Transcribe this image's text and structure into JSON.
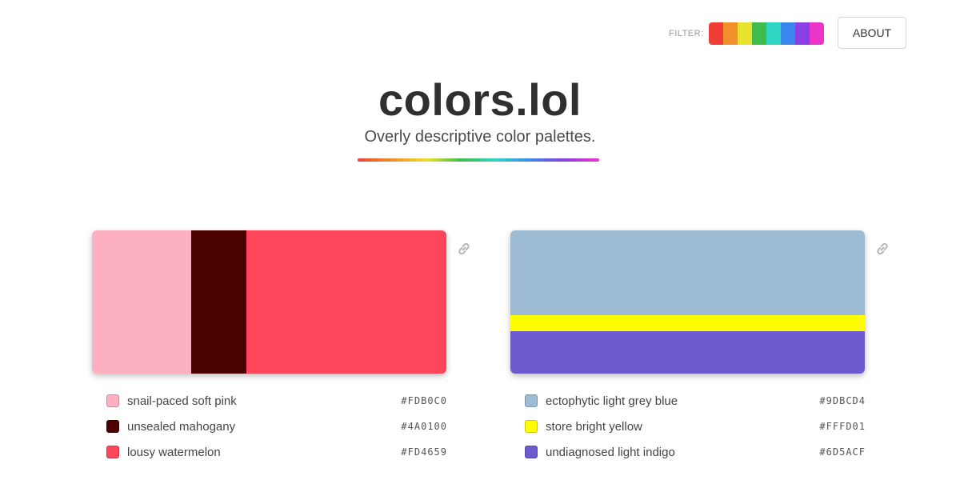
{
  "header": {
    "filter_label": "FILTER:",
    "filter_colors": [
      "#ef3e36",
      "#f08f2c",
      "#e9e22c",
      "#3fbc4d",
      "#2fd4c2",
      "#3a86ec",
      "#8a3ee6",
      "#ec34c9"
    ],
    "about_label": "ABOUT"
  },
  "hero": {
    "title": "colors.lol",
    "subtitle": "Overly descriptive color palettes."
  },
  "palettes": [
    {
      "orientation": "horizontal",
      "link_icon": "link-icon",
      "colors": [
        {
          "name": "snail-paced soft pink",
          "hex": "#FDB0C0",
          "share": 0.28
        },
        {
          "name": "unsealed mahogany",
          "hex": "#4A0100",
          "share": 0.155
        },
        {
          "name": "lousy watermelon",
          "hex": "#FD4659",
          "share": 0.565
        }
      ]
    },
    {
      "orientation": "vertical",
      "link_icon": "link-icon",
      "colors": [
        {
          "name": "ectophytic light grey blue",
          "hex": "#9DBCD4",
          "share": 0.59
        },
        {
          "name": "store bright yellow",
          "hex": "#FFFD01",
          "share": 0.115
        },
        {
          "name": "undiagnosed light indigo",
          "hex": "#6D5ACF",
          "share": 0.295
        }
      ]
    }
  ]
}
